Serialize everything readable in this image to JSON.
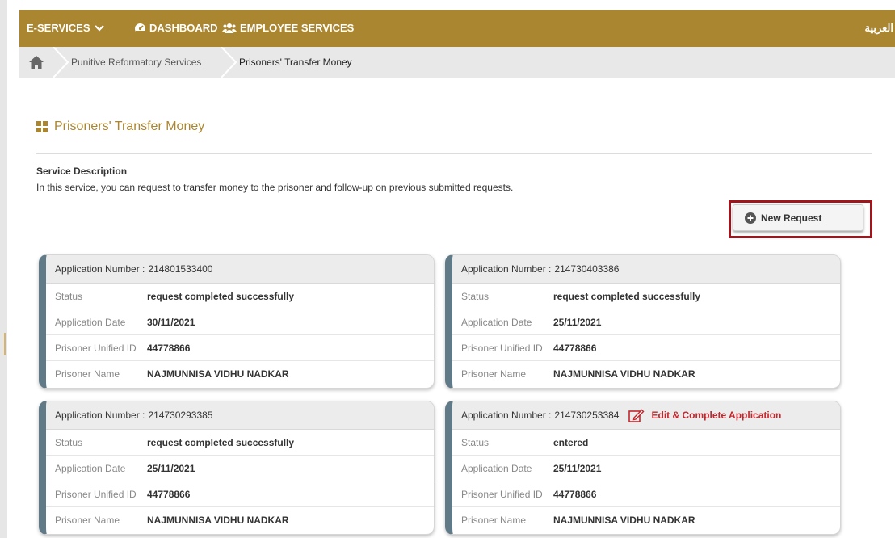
{
  "nav": {
    "eservices": "E-SERVICES",
    "dashboard": "DASHBOARD",
    "employee_services": "EMPLOYEE SERVICES",
    "language": "العربية"
  },
  "breadcrumb": {
    "items": [
      "Punitive Reformatory Services",
      "Prisoners' Transfer Money"
    ]
  },
  "page": {
    "title": "Prisoners' Transfer Money",
    "service_heading": "Service Description",
    "service_description": "In this service, you can request to transfer money to the prisoner and follow-up on previous submitted requests.",
    "new_request_label": "New Request"
  },
  "labels": {
    "application_number": "Application Number :",
    "status": "Status",
    "application_date": "Application Date",
    "prisoner_unified_id": "Prisoner Unified ID",
    "prisoner_name": "Prisoner Name",
    "edit_complete": "Edit & Complete Application"
  },
  "applications": [
    {
      "number": "214801533400",
      "status": "request completed successfully",
      "date": "30/11/2021",
      "unified_id": "44778866",
      "name": "NAJMUNNISA VIDHU NADKAR"
    },
    {
      "number": "214730403386",
      "status": "request completed successfully",
      "date": "25/11/2021",
      "unified_id": "44778866",
      "name": "NAJMUNNISA VIDHU NADKAR"
    },
    {
      "number": "214730293385",
      "status": "request completed successfully",
      "date": "25/11/2021",
      "unified_id": "44778866",
      "name": "NAJMUNNISA VIDHU NADKAR"
    },
    {
      "number": "214730253384",
      "status": "entered",
      "date": "25/11/2021",
      "unified_id": "44778866",
      "name": "NAJMUNNISA VIDHU NADKAR"
    }
  ],
  "colors": {
    "nav_bg": "#ab8631",
    "accent_red": "#c1272d",
    "card_border": "#617a88"
  }
}
